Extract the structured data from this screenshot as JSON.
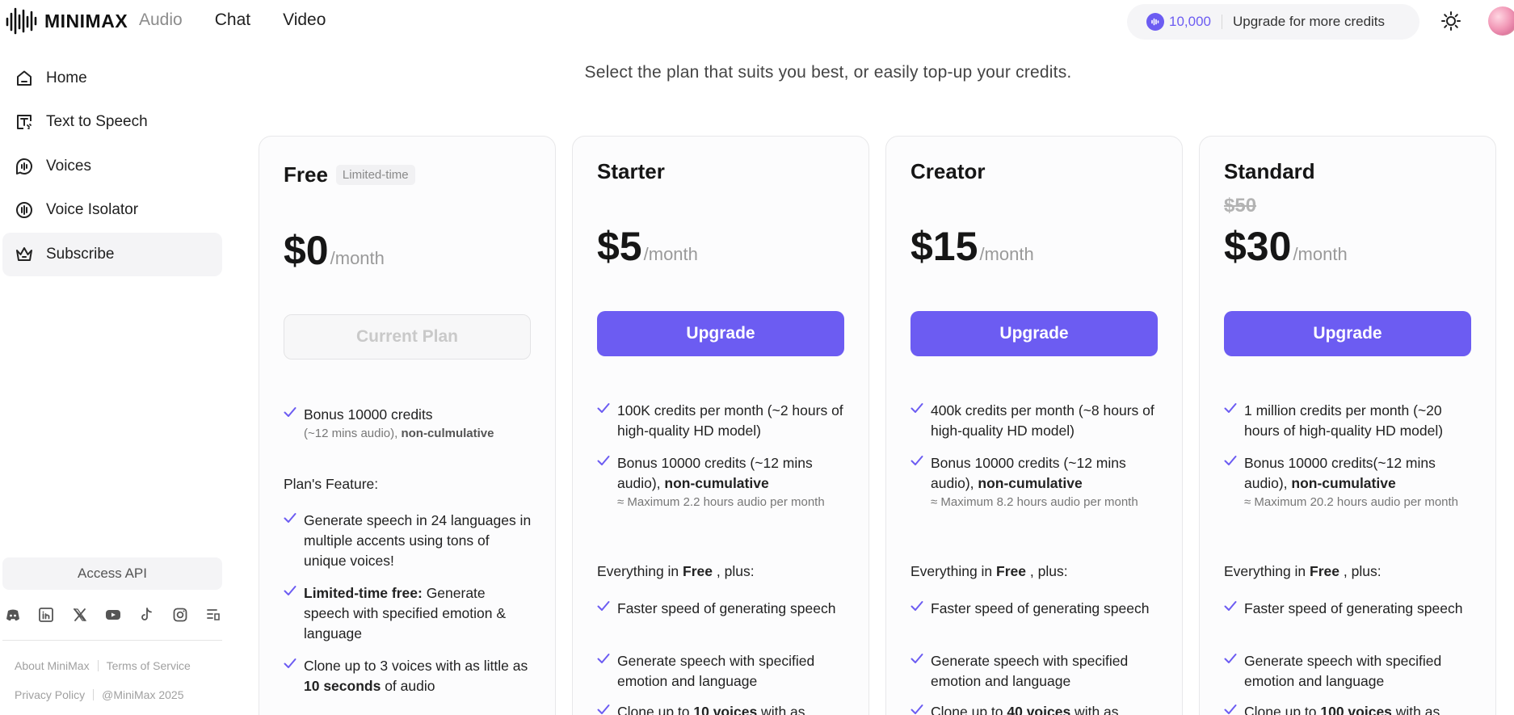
{
  "brand": {
    "logo_text": "MINIMAX"
  },
  "topnav": {
    "audio": "Audio",
    "chat": "Chat",
    "video": "Video"
  },
  "credits": {
    "amount": "10,000",
    "upgrade_label": "Upgrade for more credits"
  },
  "sidebar": {
    "items": [
      {
        "label": "Home",
        "icon": "home-icon"
      },
      {
        "label": "Text to Speech",
        "icon": "text-to-speech-icon"
      },
      {
        "label": "Voices",
        "icon": "voices-icon"
      },
      {
        "label": "Voice Isolator",
        "icon": "voice-isolator-icon"
      },
      {
        "label": "Subscribe",
        "icon": "crown-icon"
      }
    ],
    "access_api": "Access API",
    "socials": [
      "discord-icon",
      "linkedin-icon",
      "x-icon",
      "youtube-icon",
      "tiktok-icon",
      "instagram-icon",
      "feed-icon"
    ],
    "footer": {
      "about": "About MiniMax",
      "terms": "Terms of Service",
      "privacy": "Privacy Policy",
      "copyright": "@MiniMax 2025"
    }
  },
  "main": {
    "subtitle": "Select the plan that suits you best, or easily top-up your credits.",
    "plans": [
      {
        "name": "Free",
        "tag": "Limited-time",
        "price": "$0",
        "per": "/month",
        "button": "Current Plan",
        "bonus_main": "Bonus 10000 credits",
        "bonus_sub": "(~12 mins audio), ",
        "bonus_bold": "non-culmulative",
        "features_label": "Plan's Feature:",
        "f1": "Generate speech in 24 languages in multiple accents using tons of unique voices!",
        "f2_bold": "Limited-time free:",
        "f2": " Generate speech with specified emotion & language",
        "f3_a": "Clone up to 3 voices with as little as ",
        "f3_bold": "10 seconds",
        "f3_b": " of audio"
      },
      {
        "name": "Starter",
        "price": "$5",
        "per": "/month",
        "button": "Upgrade",
        "credits_line": "100K credits per month (~2 hours of high-quality HD model)",
        "bonus_a": "Bonus 10000 credits (~12 mins audio), ",
        "bonus_bold": "non-cumulative",
        "bonus_sub": "≈ Maximum 2.2 hours audio per month",
        "everything_a": "Everything in ",
        "everything_bold": "Free",
        "everything_b": " , plus:",
        "f1": "Faster speed of generating speech",
        "f2": "Generate speech with specified emotion and language",
        "f3_a": "Clone up to ",
        "f3_bold": "10 voices",
        "f3_b": " with as"
      },
      {
        "name": "Creator",
        "price": "$15",
        "per": "/month",
        "button": "Upgrade",
        "credits_line": "400k credits per month (~8 hours of high-quality HD model)",
        "bonus_a": "Bonus 10000 credits (~12 mins audio), ",
        "bonus_bold": "non-cumulative",
        "bonus_sub": "≈ Maximum 8.2 hours audio per month",
        "everything_a": "Everything in ",
        "everything_bold": "Free",
        "everything_b": " , plus:",
        "f1": "Faster speed of generating speech",
        "f2": "Generate speech with specified emotion and language",
        "f3_a": "Clone up to ",
        "f3_bold": "40 voices",
        "f3_b": " with as"
      },
      {
        "name": "Standard",
        "old_price": "$50",
        "price": "$30",
        "per": "/month",
        "button": "Upgrade",
        "credits_line": "1 million credits per month (~20 hours of high-quality HD model)",
        "bonus_a": "Bonus 10000 credits(~12 mins audio), ",
        "bonus_bold": "non-cumulative",
        "bonus_sub": "≈ Maximum 20.2 hours audio per month",
        "everything_a": "Everything in ",
        "everything_bold": "Free",
        "everything_b": " , plus:",
        "f1": "Faster speed of generating speech",
        "f2": "Generate speech with specified emotion and language",
        "f3_a": "Clone up to ",
        "f3_bold": "100 voices",
        "f3_b": " with as"
      }
    ]
  },
  "colors": {
    "accent": "#6c5cf2",
    "muted": "#9a9a9a",
    "card_border": "#e8e8ea"
  }
}
